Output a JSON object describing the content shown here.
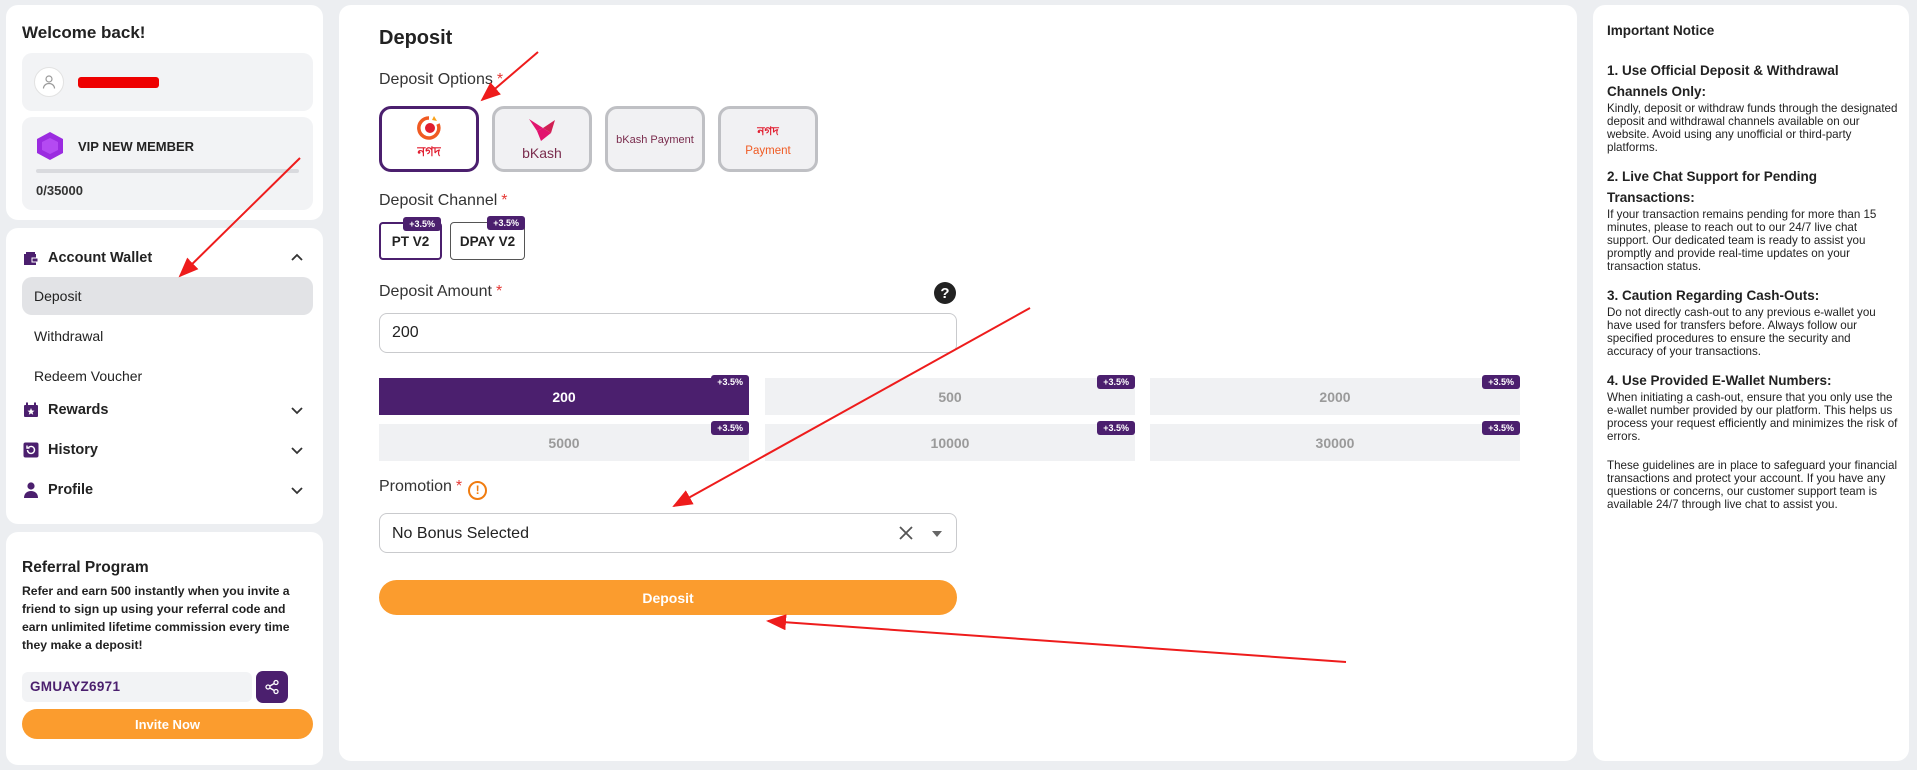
{
  "sidebar": {
    "welcome": "Welcome back!",
    "vip": {
      "label": "VIP NEW MEMBER",
      "progress_text": "0/35000",
      "progress_fraction": 0
    },
    "nav": {
      "account_wallet": "Account Wallet",
      "deposit": "Deposit",
      "withdrawal": "Withdrawal",
      "redeem_voucher": "Redeem Voucher",
      "rewards": "Rewards",
      "history": "History",
      "profile": "Profile"
    },
    "referral": {
      "title": "Referral Program",
      "text": "Refer and earn 500 instantly when you invite a friend to sign up using your referral code and earn unlimited lifetime commission every time they make a deposit!",
      "code": "GMUAYZ6971",
      "invite_label": "Invite Now"
    }
  },
  "main": {
    "title": "Deposit",
    "deposit_options_label": "Deposit Options",
    "required_mark": "*",
    "options": [
      {
        "name": "নগদ",
        "icon": "nagad-logo",
        "selected": true
      },
      {
        "name": "bKash",
        "icon": "bkash-logo",
        "selected": false
      },
      {
        "name": "bKash Payment",
        "sub": "Payment",
        "icon": "bkash-payment-logo",
        "selected": false
      },
      {
        "name": "নগদ",
        "sub": "Payment",
        "icon": "nagad-payment-logo",
        "selected": false
      }
    ],
    "deposit_channel_label": "Deposit Channel",
    "channels": [
      {
        "label": "PT V2",
        "badge": "+3.5%",
        "selected": true
      },
      {
        "label": "DPAY V2",
        "badge": "+3.5%",
        "selected": false
      }
    ],
    "deposit_amount_label": "Deposit Amount",
    "help_symbol": "?",
    "amount_value": "200",
    "amounts": [
      {
        "value": "200",
        "badge": "+3.5%",
        "selected": true
      },
      {
        "value": "500",
        "badge": "+3.5%",
        "selected": false
      },
      {
        "value": "2000",
        "badge": "+3.5%",
        "selected": false
      },
      {
        "value": "5000",
        "badge": "+3.5%",
        "selected": false
      },
      {
        "value": "10000",
        "badge": "+3.5%",
        "selected": false
      },
      {
        "value": "30000",
        "badge": "+3.5%",
        "selected": false
      }
    ],
    "promotion_label": "Promotion",
    "promotion_info_symbol": "!",
    "promotion_value": "No Bonus Selected",
    "deposit_button": "Deposit"
  },
  "notice": {
    "title": "Important Notice",
    "sections": [
      {
        "heading": "1. Use Official Deposit & Withdrawal Channels Only:",
        "body": "Kindly, deposit or withdraw funds through the designated deposit and withdrawal channels available on our website. Avoid using any unofficial or third-party platforms."
      },
      {
        "heading": "2. Live Chat Support for Pending Transactions:",
        "body": "If your transaction remains pending for more than 15 minutes, please to reach out to our 24/7 live chat support. Our dedicated team is ready to assist you promptly and provide real-time updates on your transaction status."
      },
      {
        "heading": "3. Caution Regarding Cash-Outs:",
        "body": "Do not directly cash-out to any previous e-wallet you have used for transfers before. Always follow our specified procedures to ensure the security and accuracy of your transactions."
      },
      {
        "heading": "4. Use Provided E-Wallet Numbers:",
        "body": "When initiating a cash-out, ensure that you only use the e-wallet number provided by our platform. This helps us process your request efficiently and minimizes the risk of errors."
      }
    ],
    "footer": "These guidelines are in place to safeguard your financial transactions and protect your account. If you have any questions or concerns, our customer support team is available 24/7 through live chat to assist you."
  },
  "colors": {
    "brand_purple": "#4b1f6e",
    "accent_orange": "#fb9c2e",
    "annotation_red": "#ee1c1c"
  }
}
